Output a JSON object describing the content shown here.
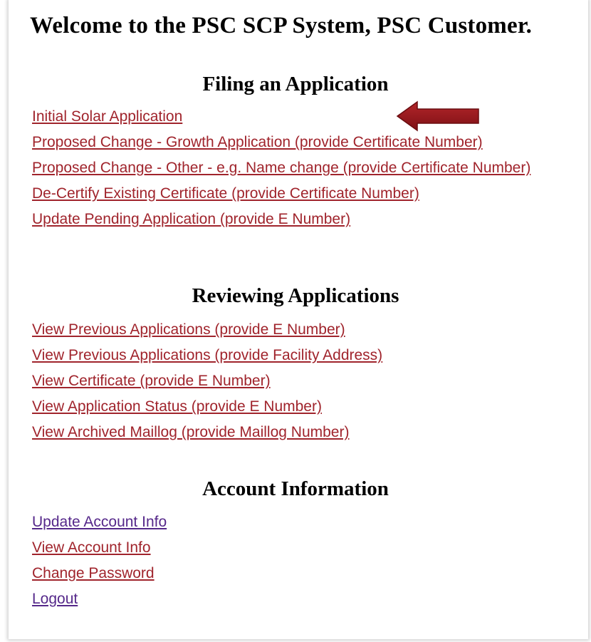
{
  "page": {
    "title": "Welcome to the PSC SCP System, PSC Customer."
  },
  "filing": {
    "heading": "Filing an Application",
    "links": [
      "Initial Solar Application",
      "Proposed Change - Growth Application (provide Certificate Number)",
      "Proposed Change - Other - e.g. Name change (provide Certificate Number)",
      "De-Certify Existing Certificate (provide Certificate Number)",
      "Update Pending Application (provide E Number)"
    ]
  },
  "reviewing": {
    "heading": "Reviewing Applications",
    "links": [
      "View Previous Applications (provide E Number)",
      "View Previous Applications (provide Facility Address)",
      "View Certificate (provide E Number)",
      "View Application Status (provide E Number)",
      "View Archived Maillog (provide Maillog Number)"
    ]
  },
  "account": {
    "heading": "Account Information",
    "links": [
      "Update Account Info",
      "View Account Info",
      "Change Password",
      "Logout"
    ]
  },
  "colors": {
    "link_red": "#a0242c",
    "link_purple": "#55288a",
    "arrow": "#9b1b1b"
  },
  "annotation": {
    "icon": "left-arrow-icon"
  }
}
